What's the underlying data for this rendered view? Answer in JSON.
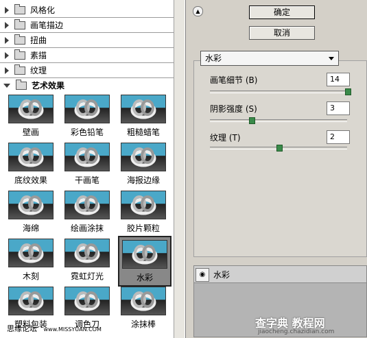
{
  "categories": [
    {
      "label": "风格化",
      "open": false
    },
    {
      "label": "画笔描边",
      "open": false
    },
    {
      "label": "扭曲",
      "open": false
    },
    {
      "label": "素描",
      "open": false
    },
    {
      "label": "纹理",
      "open": false
    },
    {
      "label": "艺术效果",
      "open": true
    }
  ],
  "filters": [
    {
      "label": "壁画"
    },
    {
      "label": "彩色铅笔"
    },
    {
      "label": "粗糙蜡笔"
    },
    {
      "label": "底纹效果"
    },
    {
      "label": "干画笔"
    },
    {
      "label": "海报边缘"
    },
    {
      "label": "海绵"
    },
    {
      "label": "绘画涂抹"
    },
    {
      "label": "胶片颗粒"
    },
    {
      "label": "木刻"
    },
    {
      "label": "霓虹灯光"
    },
    {
      "label": "水彩"
    },
    {
      "label": "塑料包装"
    },
    {
      "label": "调色刀"
    },
    {
      "label": "涂抹棒"
    }
  ],
  "selected_filter": "水彩",
  "buttons": {
    "ok": "确定",
    "cancel": "取消"
  },
  "filter_select": {
    "value": "水彩"
  },
  "params": [
    {
      "label": "画笔细节 (B)",
      "value": "14",
      "fraction": 1.0
    },
    {
      "label": "阴影强度 (S)",
      "value": "3",
      "fraction": 0.3
    },
    {
      "label": "纹理 (T)",
      "value": "2",
      "fraction": 0.5
    }
  ],
  "layer": {
    "label": "水彩"
  },
  "watermarks": {
    "left": "思缘论坛",
    "left_url": "www.MISSYUAN.COM",
    "right_main": "查字典 教程网",
    "right_url": "jiaocheng.chazidian.com"
  },
  "colors": {
    "slider_knob": "#3a8a4a",
    "panel": "#d4d0c8",
    "preview_sky": "#4aa8c8"
  }
}
